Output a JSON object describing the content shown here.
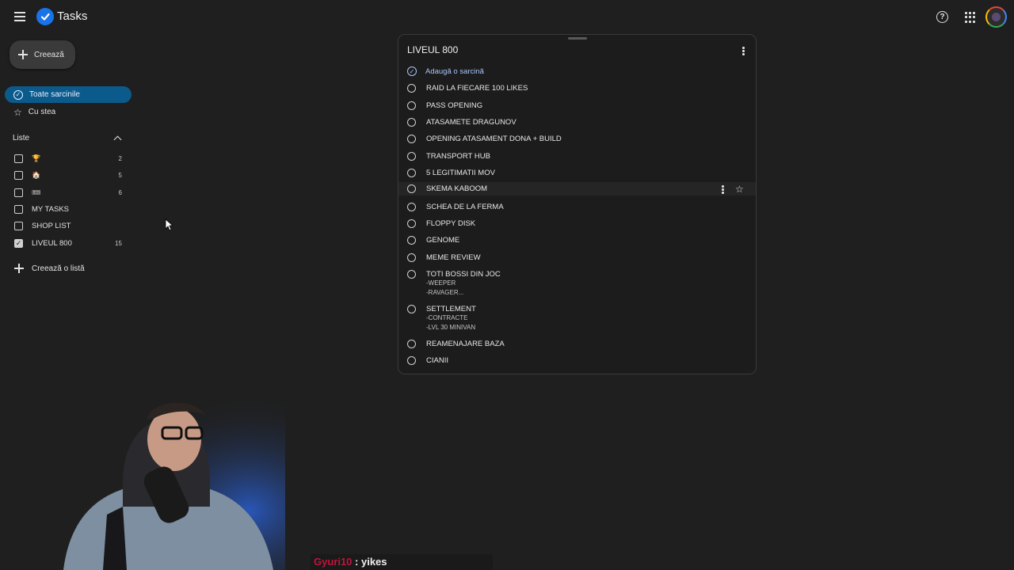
{
  "app": {
    "title": "Tasks"
  },
  "sidebar": {
    "create_label": "Creează",
    "nav": [
      {
        "label": "Toate sarcinile",
        "active": true
      },
      {
        "label": "Cu stea",
        "active": false
      }
    ],
    "lists_header": "Liste",
    "lists": [
      {
        "label": "🏆",
        "count": "2",
        "checked": false
      },
      {
        "label": "🏠",
        "count": "5",
        "checked": false
      },
      {
        "label": "🎟",
        "count": "6",
        "checked": false
      },
      {
        "label": "MY TASKS",
        "count": "",
        "checked": false
      },
      {
        "label": "SHOP LIST",
        "count": "",
        "checked": false
      },
      {
        "label": "LIVEUL 800",
        "count": "15",
        "checked": true
      }
    ],
    "create_list_label": "Creează o listă"
  },
  "panel": {
    "title": "LIVEUL 800",
    "add_task_label": "Adaugă o sarcină",
    "tasks": [
      {
        "title": "RAID LA FIECARE 100 LIKES",
        "notes": []
      },
      {
        "title": "PASS OPENING",
        "notes": []
      },
      {
        "title": "ATASAMETE DRAGUNOV",
        "notes": []
      },
      {
        "title": "OPENING ATASAMENT DONA + BUILD",
        "notes": []
      },
      {
        "title": "TRANSPORT HUB",
        "notes": []
      },
      {
        "title": "5 LEGITIMATII MOV",
        "notes": []
      },
      {
        "title": "SKEMA KABOOM",
        "notes": [],
        "hovered": true
      },
      {
        "title": "SCHEA DE LA FERMA",
        "notes": []
      },
      {
        "title": "FLOPPY DISK",
        "notes": []
      },
      {
        "title": "GENOME",
        "notes": []
      },
      {
        "title": "MEME REVIEW",
        "notes": []
      },
      {
        "title": "TOTI BOSSI DIN JOC",
        "notes": [
          "-WEEPER",
          "-RAVAGER..."
        ]
      },
      {
        "title": "SETTLEMENT",
        "notes": [
          "-CONTRACTE",
          "-LVL 30 MINIVAN"
        ]
      },
      {
        "title": "REAMENAJARE BAZA",
        "notes": []
      },
      {
        "title": "CIANII",
        "notes": []
      }
    ]
  },
  "chat": {
    "user": "Gyuri10",
    "separator": " : ",
    "message": "yikes"
  },
  "colors": {
    "accent_active": "#0b5a8c",
    "add_task": "#a8c7fa",
    "chat_user": "#c0143c",
    "background": "#1f1f1f"
  }
}
